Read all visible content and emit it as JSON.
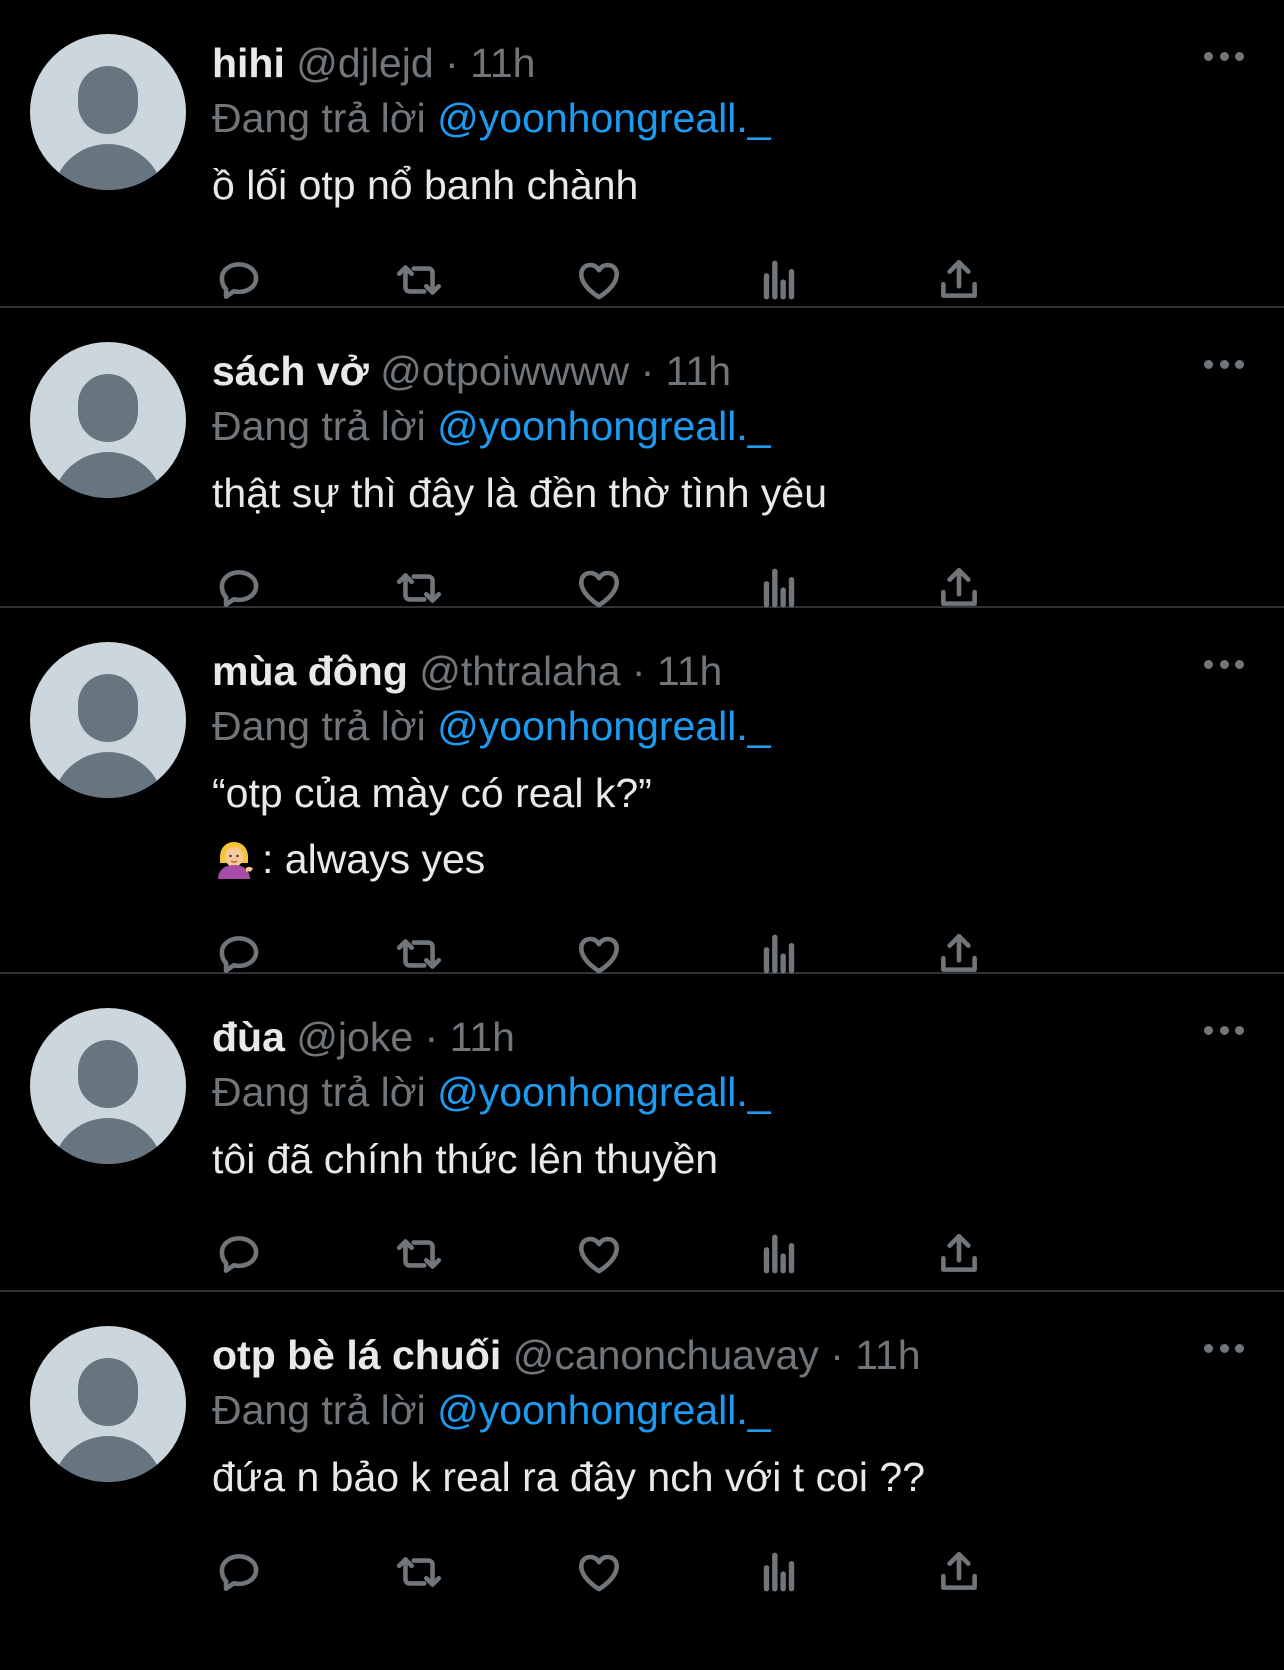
{
  "tweets": [
    {
      "display_name": "hihi",
      "handle": "@djlejd",
      "separator": "·",
      "time": "11h",
      "reply_label": "Đang trả lời",
      "reply_to": "@yoonhongreall._",
      "lines": [
        "ồ lối otp nổ banh chành"
      ]
    },
    {
      "display_name": "sách vở",
      "handle": "@otpoiwwww",
      "separator": "·",
      "time": "11h",
      "reply_label": "Đang trả lời",
      "reply_to": "@yoonhongreall._",
      "lines": [
        "thật sự thì đây là đền thờ tình yêu"
      ]
    },
    {
      "display_name": "mùa đông",
      "handle": "@thtralaha",
      "separator": "·",
      "time": "11h",
      "reply_label": "Đang trả lời",
      "reply_to": "@yoonhongreall._",
      "lines": [
        "“otp của mày có real k?”",
        ": always yes"
      ],
      "emoji_icon": "woman-tipping-hand-emoji"
    },
    {
      "display_name": "đùa",
      "handle": "@joke",
      "separator": "·",
      "time": "11h",
      "reply_label": "Đang trả lời",
      "reply_to": "@yoonhongreall._",
      "lines": [
        "tôi đã chính thức lên thuyền"
      ]
    },
    {
      "display_name": "otp bè lá chuối",
      "handle": "@canonchuavay",
      "separator": "·",
      "time": "11h",
      "reply_label": "Đang trả lời",
      "reply_to": "@yoonhongreall._",
      "lines": [
        "đứa n bảo k real ra đây nch với t coi ??"
      ]
    }
  ],
  "icons": {
    "more": "more-icon",
    "reply": "reply-icon",
    "retweet": "retweet-icon",
    "like": "heart-icon",
    "views": "views-icon",
    "share": "share-icon"
  },
  "colors": {
    "background": "#000000",
    "text_primary": "#e7e9ea",
    "text_secondary": "#71767b",
    "link": "#1d9bf0",
    "divider": "#2f3336",
    "avatar_bg": "#ccd6dd",
    "avatar_fg": "#66757f"
  }
}
